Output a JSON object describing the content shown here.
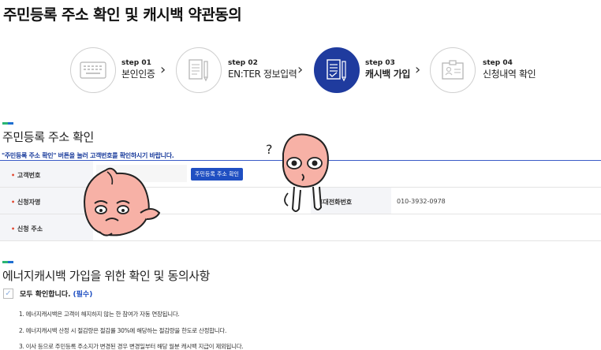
{
  "page": {
    "title": "주민등록 주소 확인 및 캐시백 약관동의"
  },
  "steps": [
    {
      "num": "step 01",
      "name": "본인인증",
      "icon": "keyboard-icon",
      "active": false
    },
    {
      "num": "step 02",
      "name": "EN:TER 정보입력",
      "icon": "document-pen-icon",
      "active": false
    },
    {
      "num": "step 03",
      "name": "캐시백 가입",
      "icon": "document-pen-icon",
      "active": true
    },
    {
      "num": "step 04",
      "name": "신청내역 확인",
      "icon": "id-card-icon",
      "active": false
    }
  ],
  "colors": {
    "accent": "#1f3b9e",
    "button": "#1f4fc2",
    "required": "#e2472f",
    "character": "#f7b1a6"
  },
  "address_section": {
    "title": "주민등록 주소 확인",
    "notice": "\"주민등록 주소 확인\" 버튼을 눌러 고객번호를 확인하시기 바랍니다.",
    "req_mark": "•",
    "rows": {
      "customer_no": {
        "label": "고객번호",
        "button": "주민등록 주소 확인"
      },
      "applicant": {
        "label": "신청자명",
        "phone_label": "휴대전화번호",
        "phone_value": "010-3932-0978"
      },
      "address": {
        "label": "신청 주소"
      }
    }
  },
  "consent_section": {
    "title": "에너지캐시백 가입을 위한 확인 및 동의사항",
    "check_all_label": "모두 확인합니다.",
    "check_all_required": "(필수)",
    "terms": [
      "1. 에너지캐시백은 고객이 해지하지 않는 한 참여가 자동 연장됩니다.",
      "2. 에너지캐시백 산정 시 절감량은 절감률 30%에 해당하는 절감량을 한도로 산정합니다.",
      "3. 이사 등으로 주민등록 주소지가 변경된 경우 변경일부터 해당 월분 캐시백 지급이 제외됩니다."
    ]
  }
}
